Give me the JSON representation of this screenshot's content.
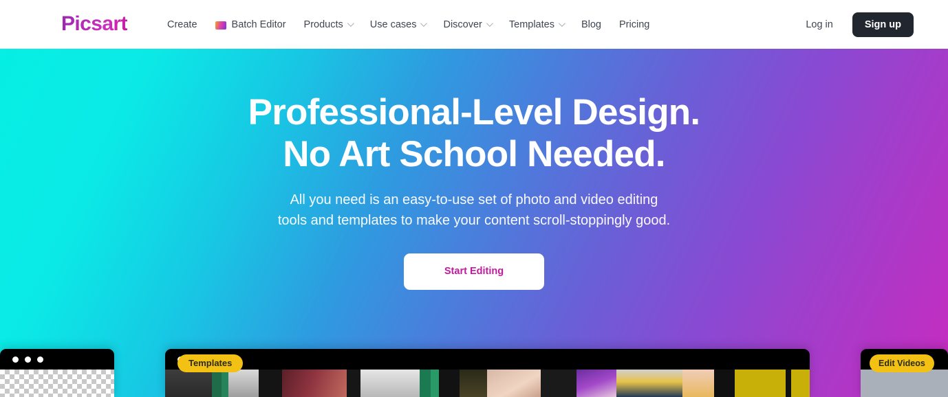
{
  "header": {
    "logo_text": "Picsart",
    "nav_items": [
      {
        "label": "Create",
        "icon": "",
        "has_caret": false
      },
      {
        "label": "Batch Editor",
        "icon": "image-icon",
        "has_caret": false
      },
      {
        "label": "Products",
        "icon": "",
        "has_caret": true
      },
      {
        "label": "Use cases",
        "icon": "",
        "has_caret": true
      },
      {
        "label": "Discover",
        "icon": "",
        "has_caret": true
      },
      {
        "label": "Templates",
        "icon": "",
        "has_caret": true
      },
      {
        "label": "Blog",
        "icon": "",
        "has_caret": false
      },
      {
        "label": "Pricing",
        "icon": "",
        "has_caret": false
      }
    ],
    "login_label": "Log in",
    "signup_label": "Sign up"
  },
  "hero": {
    "headline_line1": "Professional-Level Design.",
    "headline_line2": "No Art School Needed.",
    "subhead_line1": "All you need is an easy-to-use set of photo and video editing",
    "subhead_line2": "tools and templates to make your content scroll-stoppingly good.",
    "cta_label": "Start Editing"
  },
  "cards": {
    "center_pill_label": "Templates",
    "right_pill_label": "Edit Videos"
  },
  "colors": {
    "gradient_start": "#06EFE4",
    "gradient_end": "#C72BBF",
    "brand_magenta": "#C2199F",
    "signup_dark": "#22262E",
    "pill_yellow": "#F2C113",
    "nav_text": "#3F4651"
  }
}
